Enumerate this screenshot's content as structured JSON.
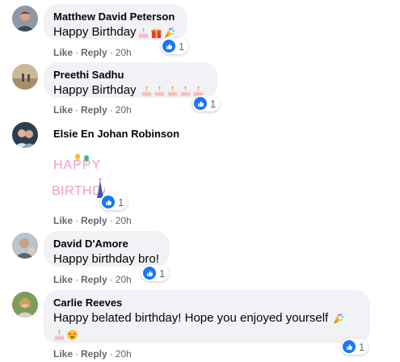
{
  "comments": [
    {
      "author": "Matthew David Peterson",
      "text": "Happy Birthday",
      "emojis": [
        "birthday-cake",
        "gift",
        "party-popper"
      ],
      "reaction_count": "1",
      "actions": {
        "like": "Like",
        "reply": "Reply",
        "time": "20h"
      }
    },
    {
      "author": "Preethi Sadhu",
      "text": "Happy Birthday",
      "emojis": [
        "birthday-cake",
        "birthday-cake",
        "birthday-cake",
        "birthday-cake",
        "birthday-cake"
      ],
      "reaction_count": "1",
      "actions": {
        "like": "Like",
        "reply": "Reply",
        "time": "20h"
      }
    },
    {
      "author": "Elsie En Johan Robinson",
      "sticker_letters_top": "HAPPY",
      "sticker_letters_bottom": "BIRTHDAY",
      "reaction_count": "1",
      "actions": {
        "like": "Like",
        "reply": "Reply",
        "time": "20h"
      }
    },
    {
      "author": "David D'Amore",
      "text": "Happy birthday bro!",
      "reaction_count": "1",
      "actions": {
        "like": "Like",
        "reply": "Reply",
        "time": "20h"
      }
    },
    {
      "author": "Carlie Reeves",
      "text": "Happy belated birthday! Hope you enjoyed yourself",
      "emojis": [
        "party-popper",
        "birthday-cake",
        "star-struck"
      ],
      "reaction_count": "1",
      "actions": {
        "like": "Like",
        "reply": "Reply",
        "time": "20h"
      }
    }
  ],
  "colors": {
    "like_blue": "#1877f2",
    "bubble_bg": "#f0f2f5",
    "meta_gray": "#65676b",
    "sticker_pink": "#f19bc7",
    "sticker_blue": "#3b5bb5"
  }
}
